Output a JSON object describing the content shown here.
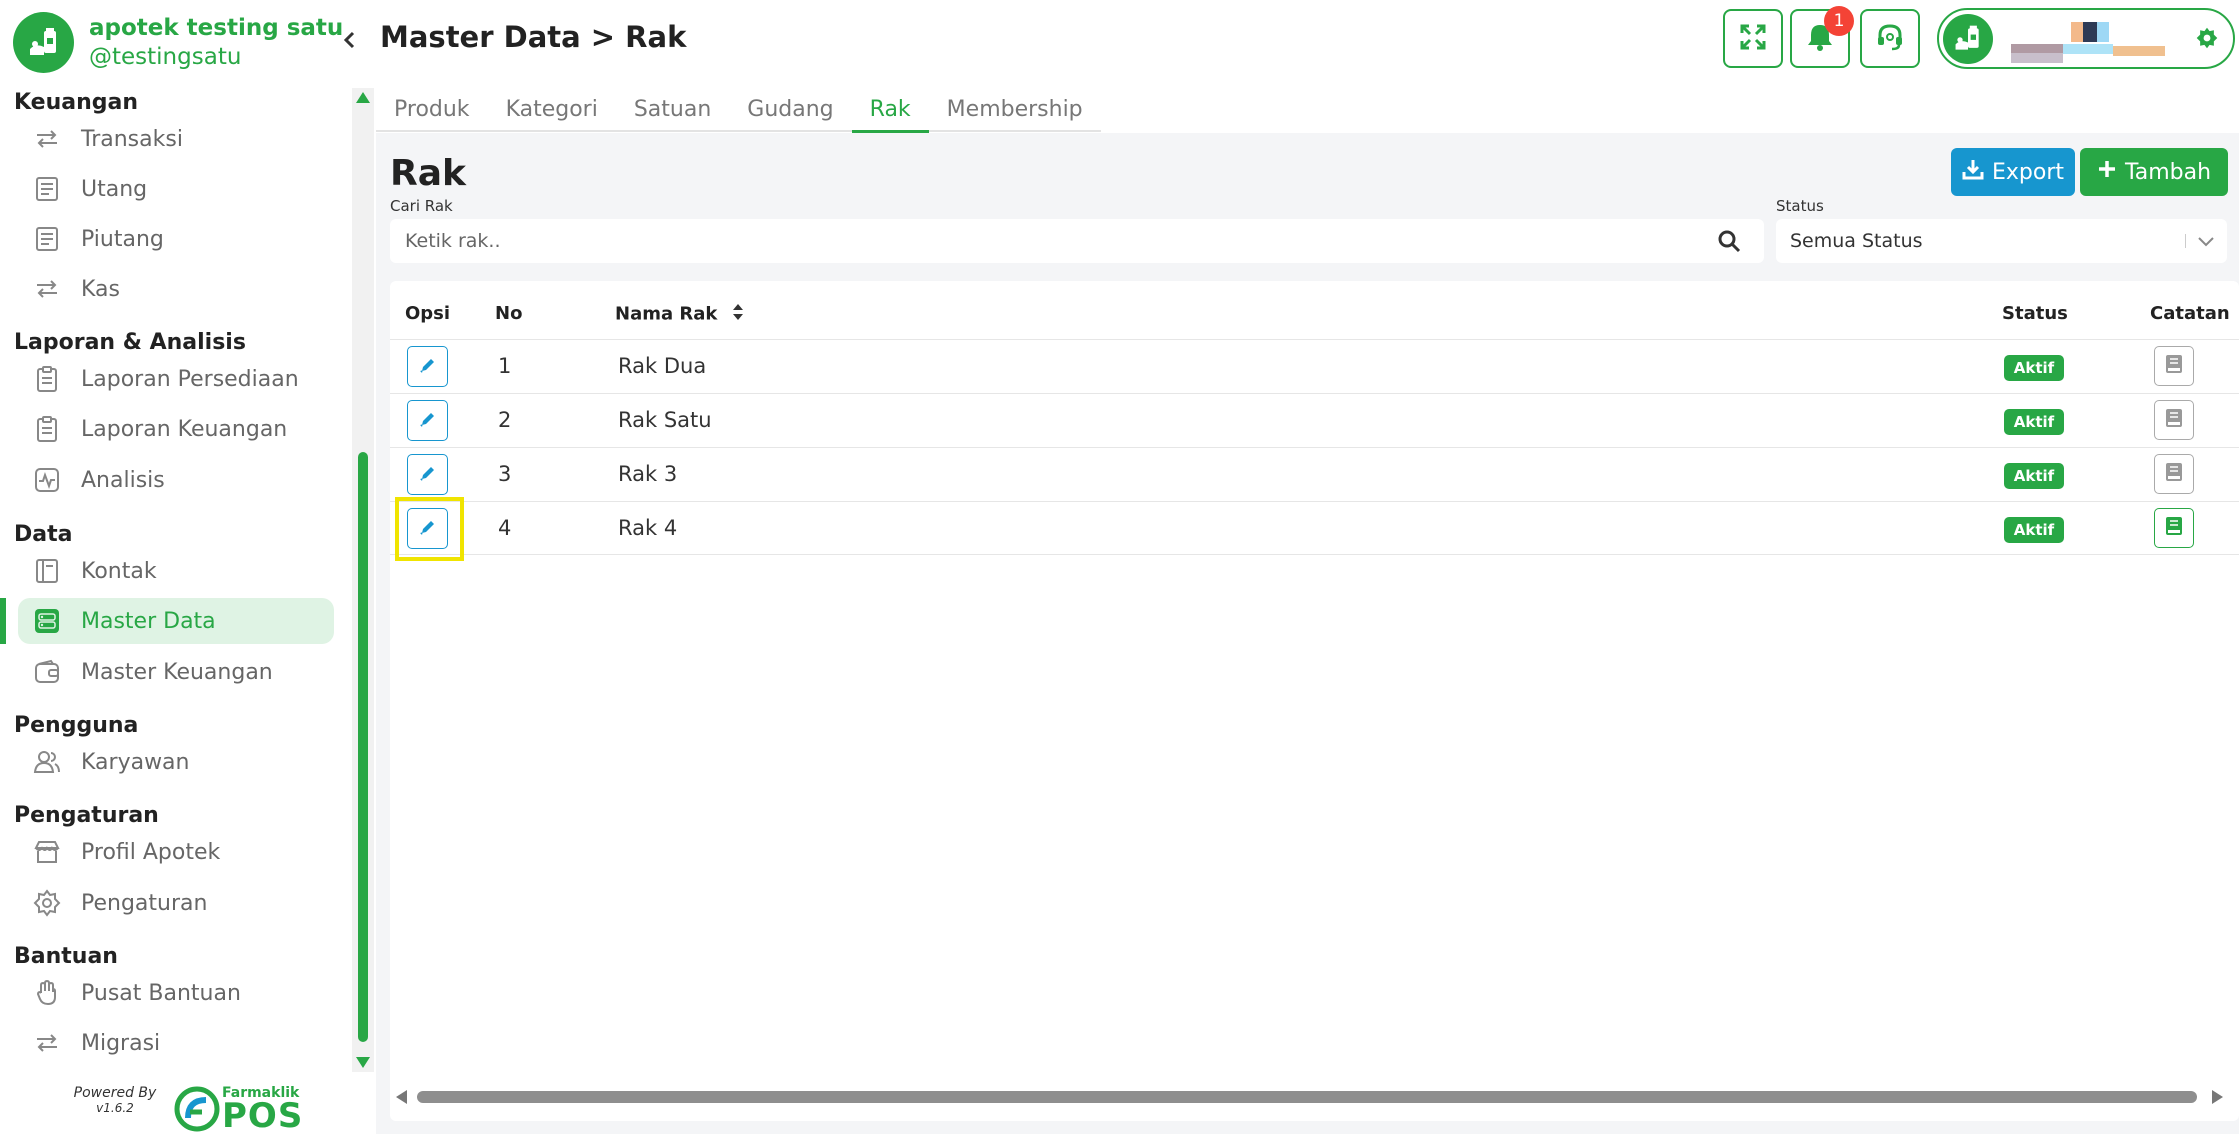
{
  "brand": {
    "name": "apotek testing satu",
    "handle": "@testingsatu"
  },
  "header": {
    "title": "Master Data > Rak",
    "notification_count": "1"
  },
  "sidebar": {
    "sections": [
      {
        "title": "Keuangan",
        "items": [
          "Transaksi",
          "Utang",
          "Piutang",
          "Kas"
        ]
      },
      {
        "title": "Laporan & Analisis",
        "items": [
          "Laporan Persediaan",
          "Laporan Keuangan",
          "Analisis"
        ]
      },
      {
        "title": "Data",
        "items": [
          "Kontak",
          "Master Data",
          "Master Keuangan"
        ]
      },
      {
        "title": "Pengguna",
        "items": [
          "Karyawan"
        ]
      },
      {
        "title": "Pengaturan",
        "items": [
          "Profil Apotek",
          "Pengaturan"
        ]
      },
      {
        "title": "Bantuan",
        "items": [
          "Pusat Bantuan",
          "Migrasi"
        ]
      }
    ],
    "active_item": "Master Data",
    "powered_by": "Powered By",
    "version": "v1.6.2",
    "logo_small": "Farmaklik",
    "logo_big": "POS"
  },
  "tabs": [
    "Produk",
    "Kategori",
    "Satuan",
    "Gudang",
    "Rak",
    "Membership"
  ],
  "active_tab": "Rak",
  "main": {
    "title": "Rak",
    "export_label": "Export",
    "add_label": "Tambah",
    "search_label": "Cari Rak",
    "search_placeholder": "Ketik rak..",
    "status_label": "Status",
    "status_value": "Semua Status"
  },
  "table": {
    "headers": {
      "opsi": "Opsi",
      "no": "No",
      "nama": "Nama Rak",
      "status": "Status",
      "catatan": "Catatan"
    },
    "rows": [
      {
        "no": "1",
        "name": "Rak Dua",
        "status": "Aktif",
        "has_note": false
      },
      {
        "no": "2",
        "name": "Rak Satu",
        "status": "Aktif",
        "has_note": false
      },
      {
        "no": "3",
        "name": "Rak 3",
        "status": "Aktif",
        "has_note": false
      },
      {
        "no": "4",
        "name": "Rak 4",
        "status": "Aktif",
        "has_note": true
      }
    ],
    "highlighted_row": 4
  },
  "colors": {
    "primary": "#28a745",
    "info": "#1796cf",
    "danger": "#f44336",
    "highlight": "#f0e400"
  },
  "icons": {
    "menu": [
      "transfer-icon",
      "receipt-icon",
      "receipt-icon",
      "transfer-icon",
      "clipboard-icon",
      "clipboard-icon",
      "pulse-icon",
      "contact-book-icon",
      "database-icon",
      "wallet-icon",
      "users-icon",
      "store-icon",
      "gear-icon",
      "hand-icon",
      "transfer-icon"
    ]
  }
}
